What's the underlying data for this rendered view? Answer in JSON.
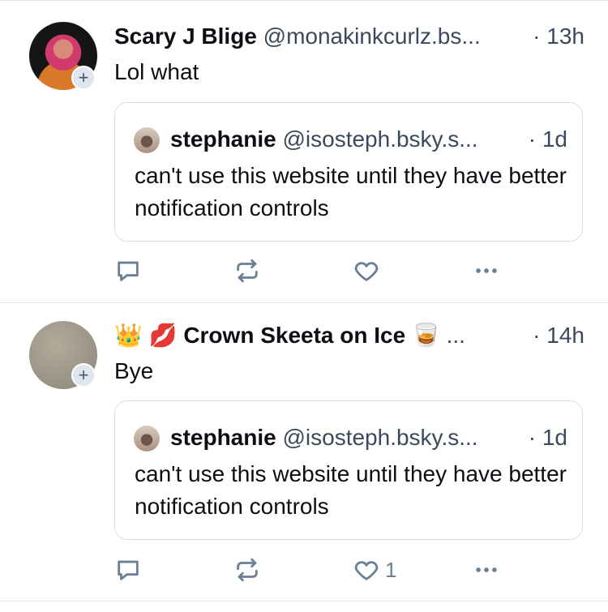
{
  "posts": [
    {
      "author": {
        "display_name": "Scary J Blige",
        "handle": "@monakinkcurlz.bs...",
        "time": "· 13h"
      },
      "text": "Lol what",
      "quote": {
        "display_name": "stephanie",
        "handle": "@isosteph.bsky.s...",
        "time": "· 1d",
        "text": "can't use this website until they have better notification controls"
      },
      "actions": {
        "like_count": ""
      }
    },
    {
      "author": {
        "emoji_1": "👑",
        "emoji_2": "💋",
        "display_name": "Crown Skeeta on Ice",
        "emoji_3": "🥃",
        "ellipsis": "...",
        "time": "· 14h"
      },
      "text": "Bye",
      "quote": {
        "display_name": "stephanie",
        "handle": "@isosteph.bsky.s...",
        "time": "· 1d",
        "text": "can't use this website until they have better notification controls"
      },
      "actions": {
        "like_count": "1"
      }
    }
  ],
  "icons": {
    "follow": "plus-icon",
    "reply": "reply-icon",
    "repost": "repost-icon",
    "like": "heart-icon",
    "more": "more-icon"
  },
  "colors": {
    "text": "#0b0f14",
    "secondary": "#3a4a5c",
    "icon": "#6b7f95",
    "border": "#dfe4ea"
  }
}
